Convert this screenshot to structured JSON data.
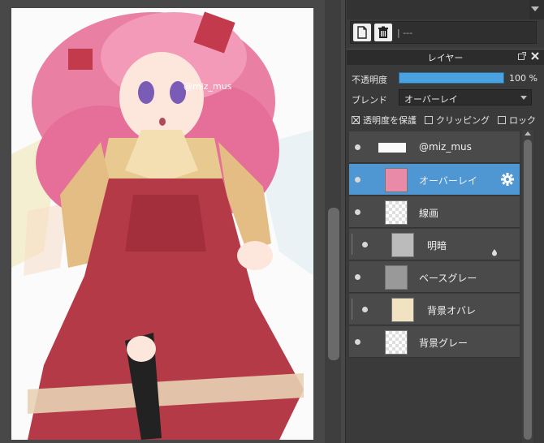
{
  "canvas": {
    "watermark": "@miz_mus"
  },
  "toolbar": {
    "new_layer_icon": "new-layer-icon",
    "delete_icon": "trash-icon",
    "separator_text": "| ---"
  },
  "panel": {
    "title": "レイヤー",
    "opacity_label": "不透明度",
    "opacity_value": "100 %",
    "opacity_fraction": 1.0,
    "blend_label": "ブレンド",
    "blend_value": "オーバーレイ",
    "checks": {
      "protect_alpha": "透明度を保護",
      "clipping": "クリッピング",
      "lock": "ロック"
    }
  },
  "layers": [
    {
      "name": "@miz_mus"
    },
    {
      "name": "オーバーレイ"
    },
    {
      "name": "線画"
    },
    {
      "name": "明暗"
    },
    {
      "name": "ベースグレー"
    },
    {
      "name": "背景オバレ"
    },
    {
      "name": "背景グレー"
    }
  ],
  "colors": {
    "selected_layer": "#4f97d3",
    "opacity_bar": "#4aa3e0"
  }
}
